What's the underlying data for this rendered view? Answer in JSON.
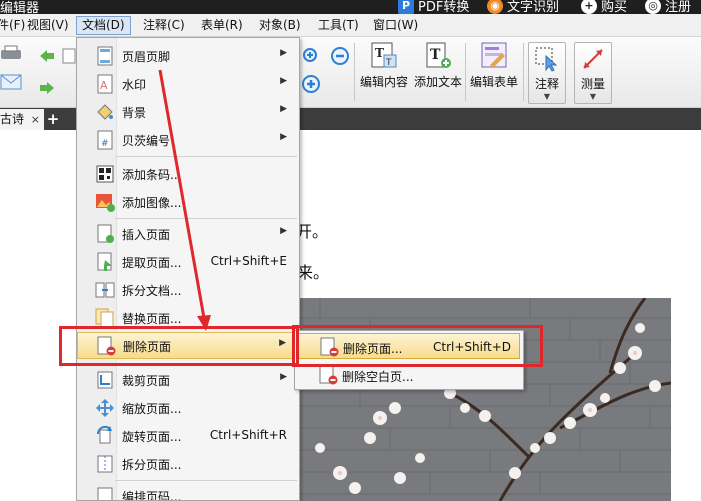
{
  "titlebar": {
    "app_title": "编辑器",
    "actions": [
      {
        "label": "PDF转换",
        "icon": "pdf-convert-icon"
      },
      {
        "label": "文字识别",
        "icon": "ocr-eye-icon"
      },
      {
        "label": "购买",
        "icon": "buy-plus-icon"
      },
      {
        "label": "注册",
        "icon": "register-icon"
      }
    ]
  },
  "menubar": {
    "items": [
      "件(F)",
      "视图(V)",
      "文档(D)",
      "注释(C)",
      "表单(R)",
      "对象(B)",
      "工具(T)",
      "窗口(W)"
    ]
  },
  "toolbar": {
    "edit_content": "编辑内容",
    "add_text": "添加文本",
    "edit_form": "编辑表单",
    "annotate": "注释",
    "measure": "测量"
  },
  "tabs": {
    "active_tab": "古诗",
    "close_glyph": "×",
    "new_tab_glyph": "+"
  },
  "document": {
    "line1": "开。",
    "line2": "来。"
  },
  "doc_menu": {
    "items": [
      {
        "label": "页眉页脚",
        "submenu": true
      },
      {
        "label": "水印",
        "submenu": true
      },
      {
        "label": "背景",
        "submenu": true
      },
      {
        "label": "贝茨编号",
        "submenu": true
      },
      {
        "label": "添加条码..."
      },
      {
        "label": "添加图像..."
      },
      {
        "label": "插入页面",
        "submenu": true
      },
      {
        "label": "提取页面...",
        "shortcut": "Ctrl+Shift+E"
      },
      {
        "label": "拆分文档..."
      },
      {
        "label": "替换页面..."
      },
      {
        "label": "删除页面",
        "submenu": true
      },
      {
        "label": "裁剪页面",
        "submenu": true
      },
      {
        "label": "缩放页面..."
      },
      {
        "label": "旋转页面...",
        "shortcut": "Ctrl+Shift+R"
      },
      {
        "label": "拆分页面..."
      },
      {
        "label": "编排页码..."
      }
    ],
    "submenu_arrow": "▶"
  },
  "delete_submenu": {
    "items": [
      {
        "label": "删除页面...",
        "shortcut": "Ctrl+Shift+D"
      },
      {
        "label": "删除空白页..."
      }
    ]
  },
  "colors": {
    "highlight_red": "#e0272b",
    "menu_hover": "#f7dc8a",
    "tab_bar": "#3c3c3c"
  }
}
